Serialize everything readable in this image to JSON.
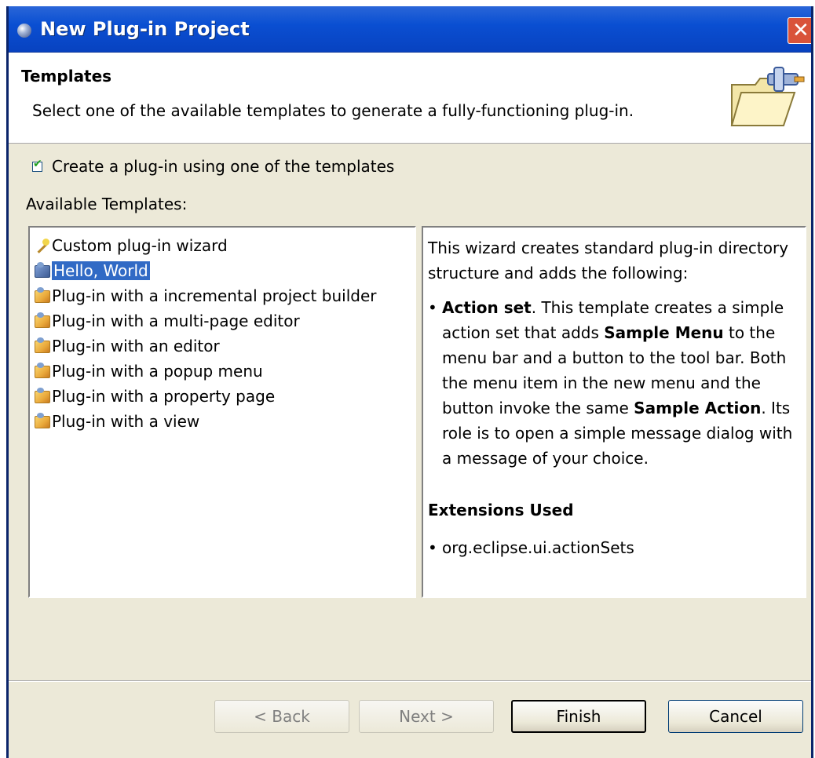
{
  "window": {
    "title": "New Plug-in Project"
  },
  "header": {
    "title": "Templates",
    "description": "Select one of the available templates to generate a fully-functioning plug-in."
  },
  "options": {
    "create_checkbox_label": "Create a plug-in using one of the templates",
    "create_checked": true,
    "available_templates_label": "Available Templates:"
  },
  "templates": [
    {
      "label": "Custom plug-in wizard",
      "icon": "wizard-wand-icon"
    },
    {
      "label": "Hello, World",
      "icon": "plugin-icon",
      "selected": true
    },
    {
      "label": "Plug-in with a incremental project builder",
      "icon": "plugin-icon"
    },
    {
      "label": "Plug-in with a multi-page editor",
      "icon": "plugin-icon"
    },
    {
      "label": "Plug-in with an editor",
      "icon": "plugin-icon"
    },
    {
      "label": "Plug-in with a popup menu",
      "icon": "plugin-icon"
    },
    {
      "label": "Plug-in with a property page",
      "icon": "plugin-icon"
    },
    {
      "label": "Plug-in with a view",
      "icon": "plugin-icon"
    }
  ],
  "description_panel": {
    "intro": "This wizard creates standard plug-in directory structure and adds the following:",
    "bullet": "•",
    "action_set_title": "Action set",
    "action_set_text_1": ". This template creates a simple action set that adds ",
    "sample_menu": "Sample Menu",
    "action_set_text_2": " to the menu bar and a button to the tool bar. Both the menu item in the new menu and the button invoke the same ",
    "sample_action": "Sample Action",
    "action_set_text_3": ". Its role is to open a simple message dialog with a message of your choice.",
    "extensions_heading": "Extensions Used",
    "extension_item": "org.eclipse.ui.actionSets"
  },
  "buttons": {
    "back": "< Back",
    "next": "Next >",
    "finish": "Finish",
    "cancel": "Cancel"
  },
  "colors": {
    "titlebar": "#0a4fd2",
    "selection": "#316ac5",
    "dialog_bg": "#ece9d8"
  }
}
